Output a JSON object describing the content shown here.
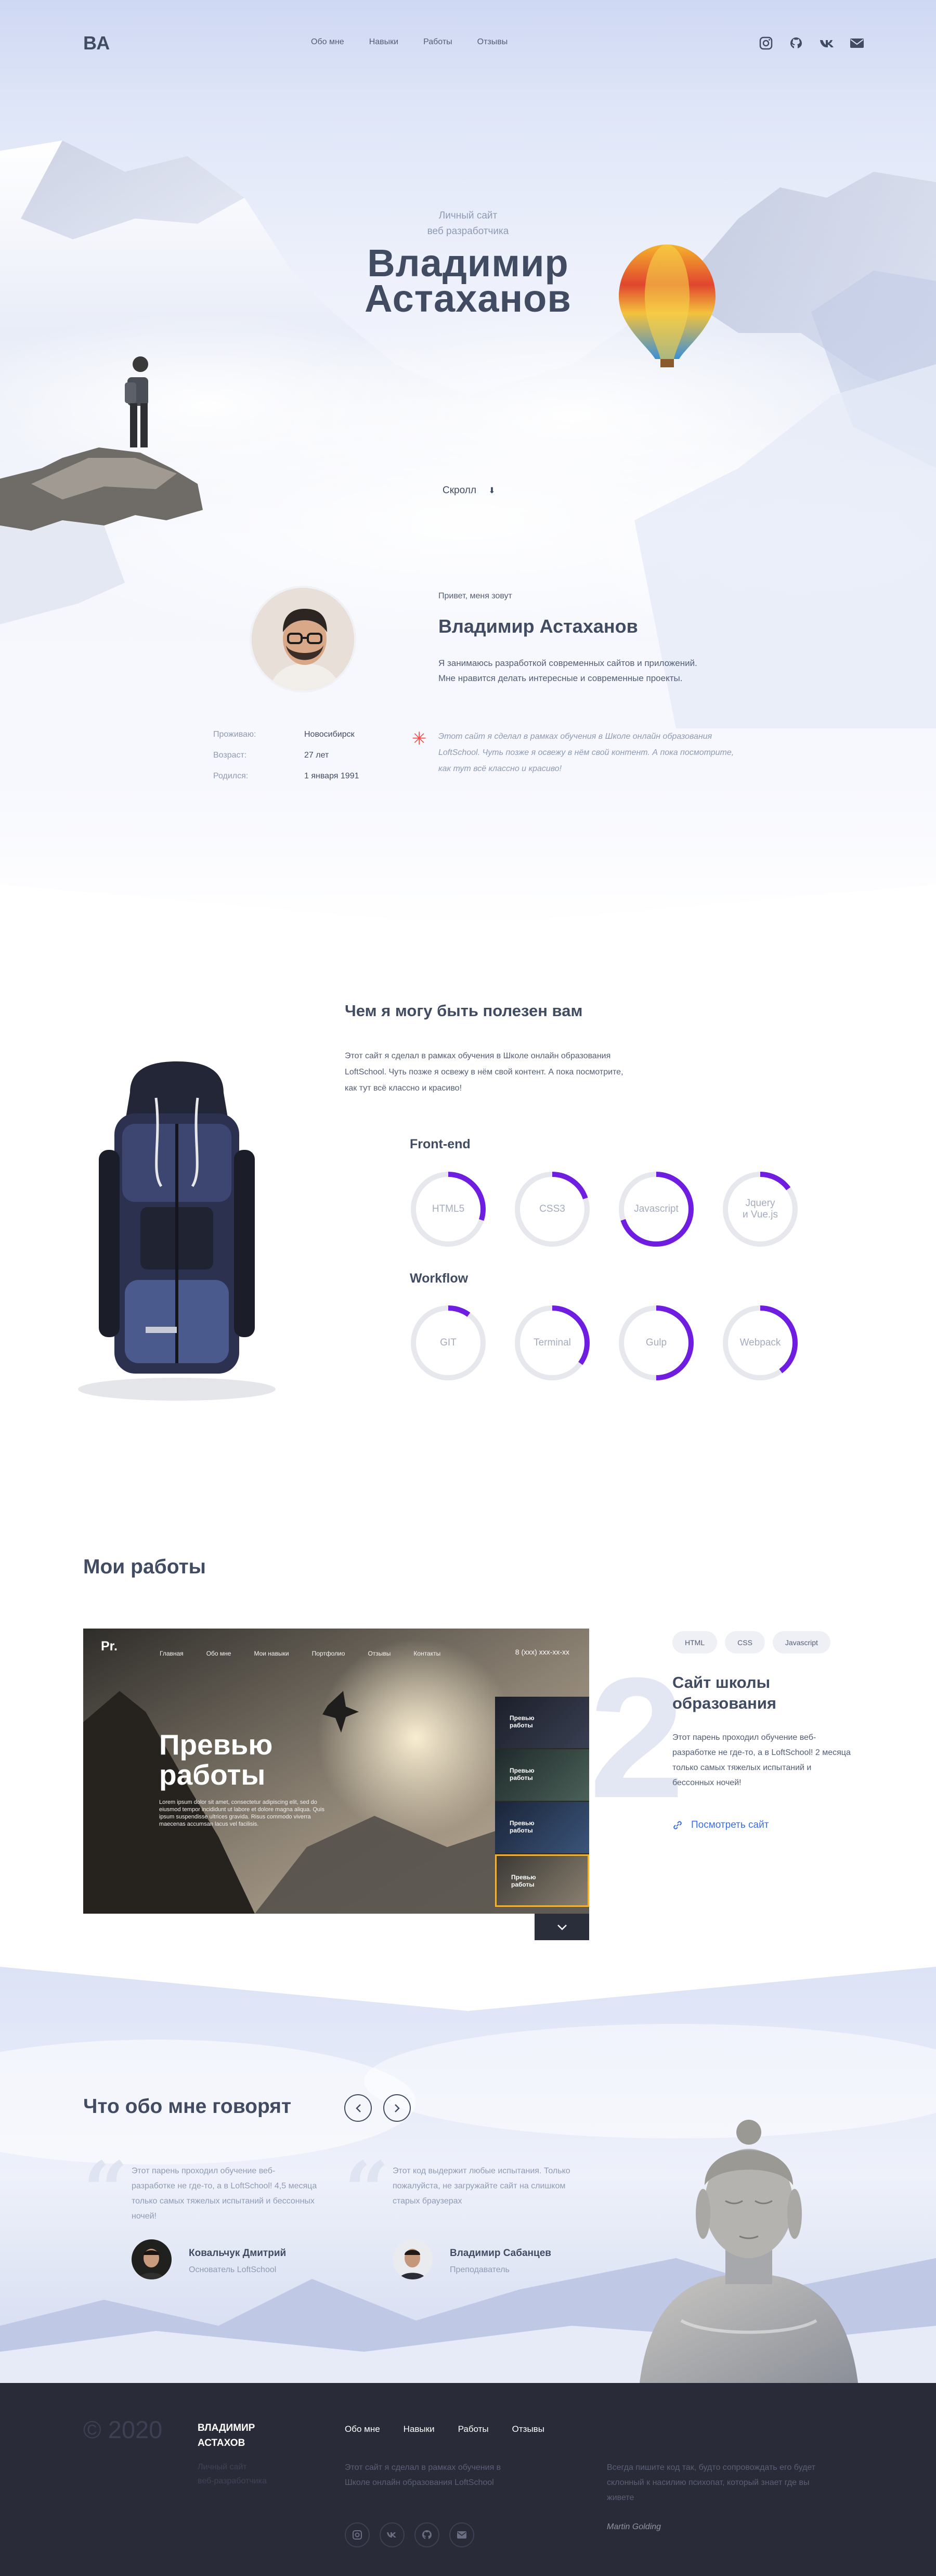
{
  "nav": {
    "logo": "ВА",
    "menu": [
      "Обо мне",
      "Навыки",
      "Работы",
      "Отзывы"
    ],
    "socials": [
      "instagram-icon",
      "github-icon",
      "vk-icon",
      "mail-icon"
    ]
  },
  "hero": {
    "subtitle_1": "Личный сайт",
    "subtitle_2": "веб разработчика",
    "name_1": "Владимир",
    "name_2": "Астаханов",
    "scroll": "Скролл"
  },
  "about": {
    "greet": "Привет, меня зовут",
    "name": "Владимир Астаханов",
    "desc_1": "Я занимаюсь разработкой современных сайтов и приложений.",
    "desc_2": "Мне нравится делать интересные и современные проекты.",
    "facts": [
      {
        "k": "Проживаю:",
        "v": "Новосибирск"
      },
      {
        "k": "Возраст:",
        "v": "27 лет"
      },
      {
        "k": "Родился:",
        "v": "1 января 1991"
      }
    ],
    "quote_1": "Этот сайт я сделал в рамках обучения в Школе онлайн образования",
    "quote_2": "LoftSchool. Чуть позже я освежу в нём свой контент. А пока посмотрите,",
    "quote_3": "как тут всё классно и красиво!"
  },
  "skills": {
    "title": "Чем я могу быть полезен вам",
    "desc_1": "Этот сайт я сделал в рамках обучения в Школе онлайн образования",
    "desc_2": "LoftSchool. Чуть позже я освежу в нём свой контент. А пока посмотрите,",
    "desc_3": "как тут всё классно и красиво!",
    "groups": [
      {
        "title": "Front-end",
        "items": [
          {
            "label": "HTML5",
            "percent": 30
          },
          {
            "label": "CSS3",
            "percent": 20
          },
          {
            "label": "Javascript",
            "percent": 70
          },
          {
            "label": "Jquery\nи Vue.js",
            "percent": 15
          }
        ]
      },
      {
        "title": "Workflow",
        "items": [
          {
            "label": "GIT",
            "percent": 10
          },
          {
            "label": "Terminal",
            "percent": 35
          },
          {
            "label": "Gulp",
            "percent": 50
          },
          {
            "label": "Webpack",
            "percent": 40
          }
        ]
      }
    ],
    "ring_color": "#6f1de0",
    "track_color": "#e7e8ed"
  },
  "works": {
    "title": "Мои работы",
    "preview": {
      "logo": "Pr.",
      "menu": [
        "Главная",
        "Обо мне",
        "Мои навыки",
        "Портфолио",
        "Отзывы",
        "Контакты"
      ],
      "phone": "8 (xxx) xxx-xx-xx",
      "head_1": "Превью",
      "head_2": "работы",
      "text": "Lorem ipsum dolor sit amet, consectetur adipiscing elit, sed do eiusmod tempor incididunt ut labore et dolore magna aliqua. Quis ipsum suspendisse ultrices gravida. Risus commodo viverra maecenas accumsan lacus vel facilisis."
    },
    "thumbs": [
      "Превью\nработы",
      "Превью\nработы",
      "Превью\nработы",
      "Превью\nработы"
    ],
    "number": "2",
    "tags": [
      "HTML",
      "CSS",
      "Javascript"
    ],
    "work_title_1": "Сайт школы",
    "work_title_2": "образования",
    "work_desc": "Этот парень проходил обучение веб-разработке не где-то, а в LoftSchool! 2 месяца только самых тяжелых испытаний и бессонных ночей!",
    "link": "Посмотреть сайт"
  },
  "reviews": {
    "title": "Что обо мне говорят",
    "items": [
      {
        "text": "Этот парень проходил обучение веб-разработке не где-то, а в LoftSchool! 4,5 месяца только самых тяжелых испытаний и бессонных ночей!",
        "name": "Ковальчук Дмитрий",
        "position": "Основатель LoftSchool"
      },
      {
        "text": "Этот код выдержит любые испытания. Только пожалуйста, не загружайте сайт на слишком старых браузерах",
        "name": "Владимир Сабанцев",
        "position": "Преподаватель"
      }
    ]
  },
  "footer": {
    "year": "© 2020",
    "name_1": "ВЛАДИМИР",
    "name_2": "АСТАХОВ",
    "sub_1": "Личный сайт",
    "sub_2": "веб-разработчика",
    "menu": [
      "Обо мне",
      "Навыки",
      "Работы",
      "Отзывы"
    ],
    "desc": "Этот сайт я сделал в рамках обучения в Школе онлайн образования LoftSchool",
    "socials": [
      "instagram-icon",
      "vk-icon",
      "github-icon",
      "mail-icon"
    ],
    "quote": "Всегда пишите код так, будто сопровождать его будет склонный к насилию психопат, который знает где вы живете",
    "author": "Martin Golding"
  }
}
